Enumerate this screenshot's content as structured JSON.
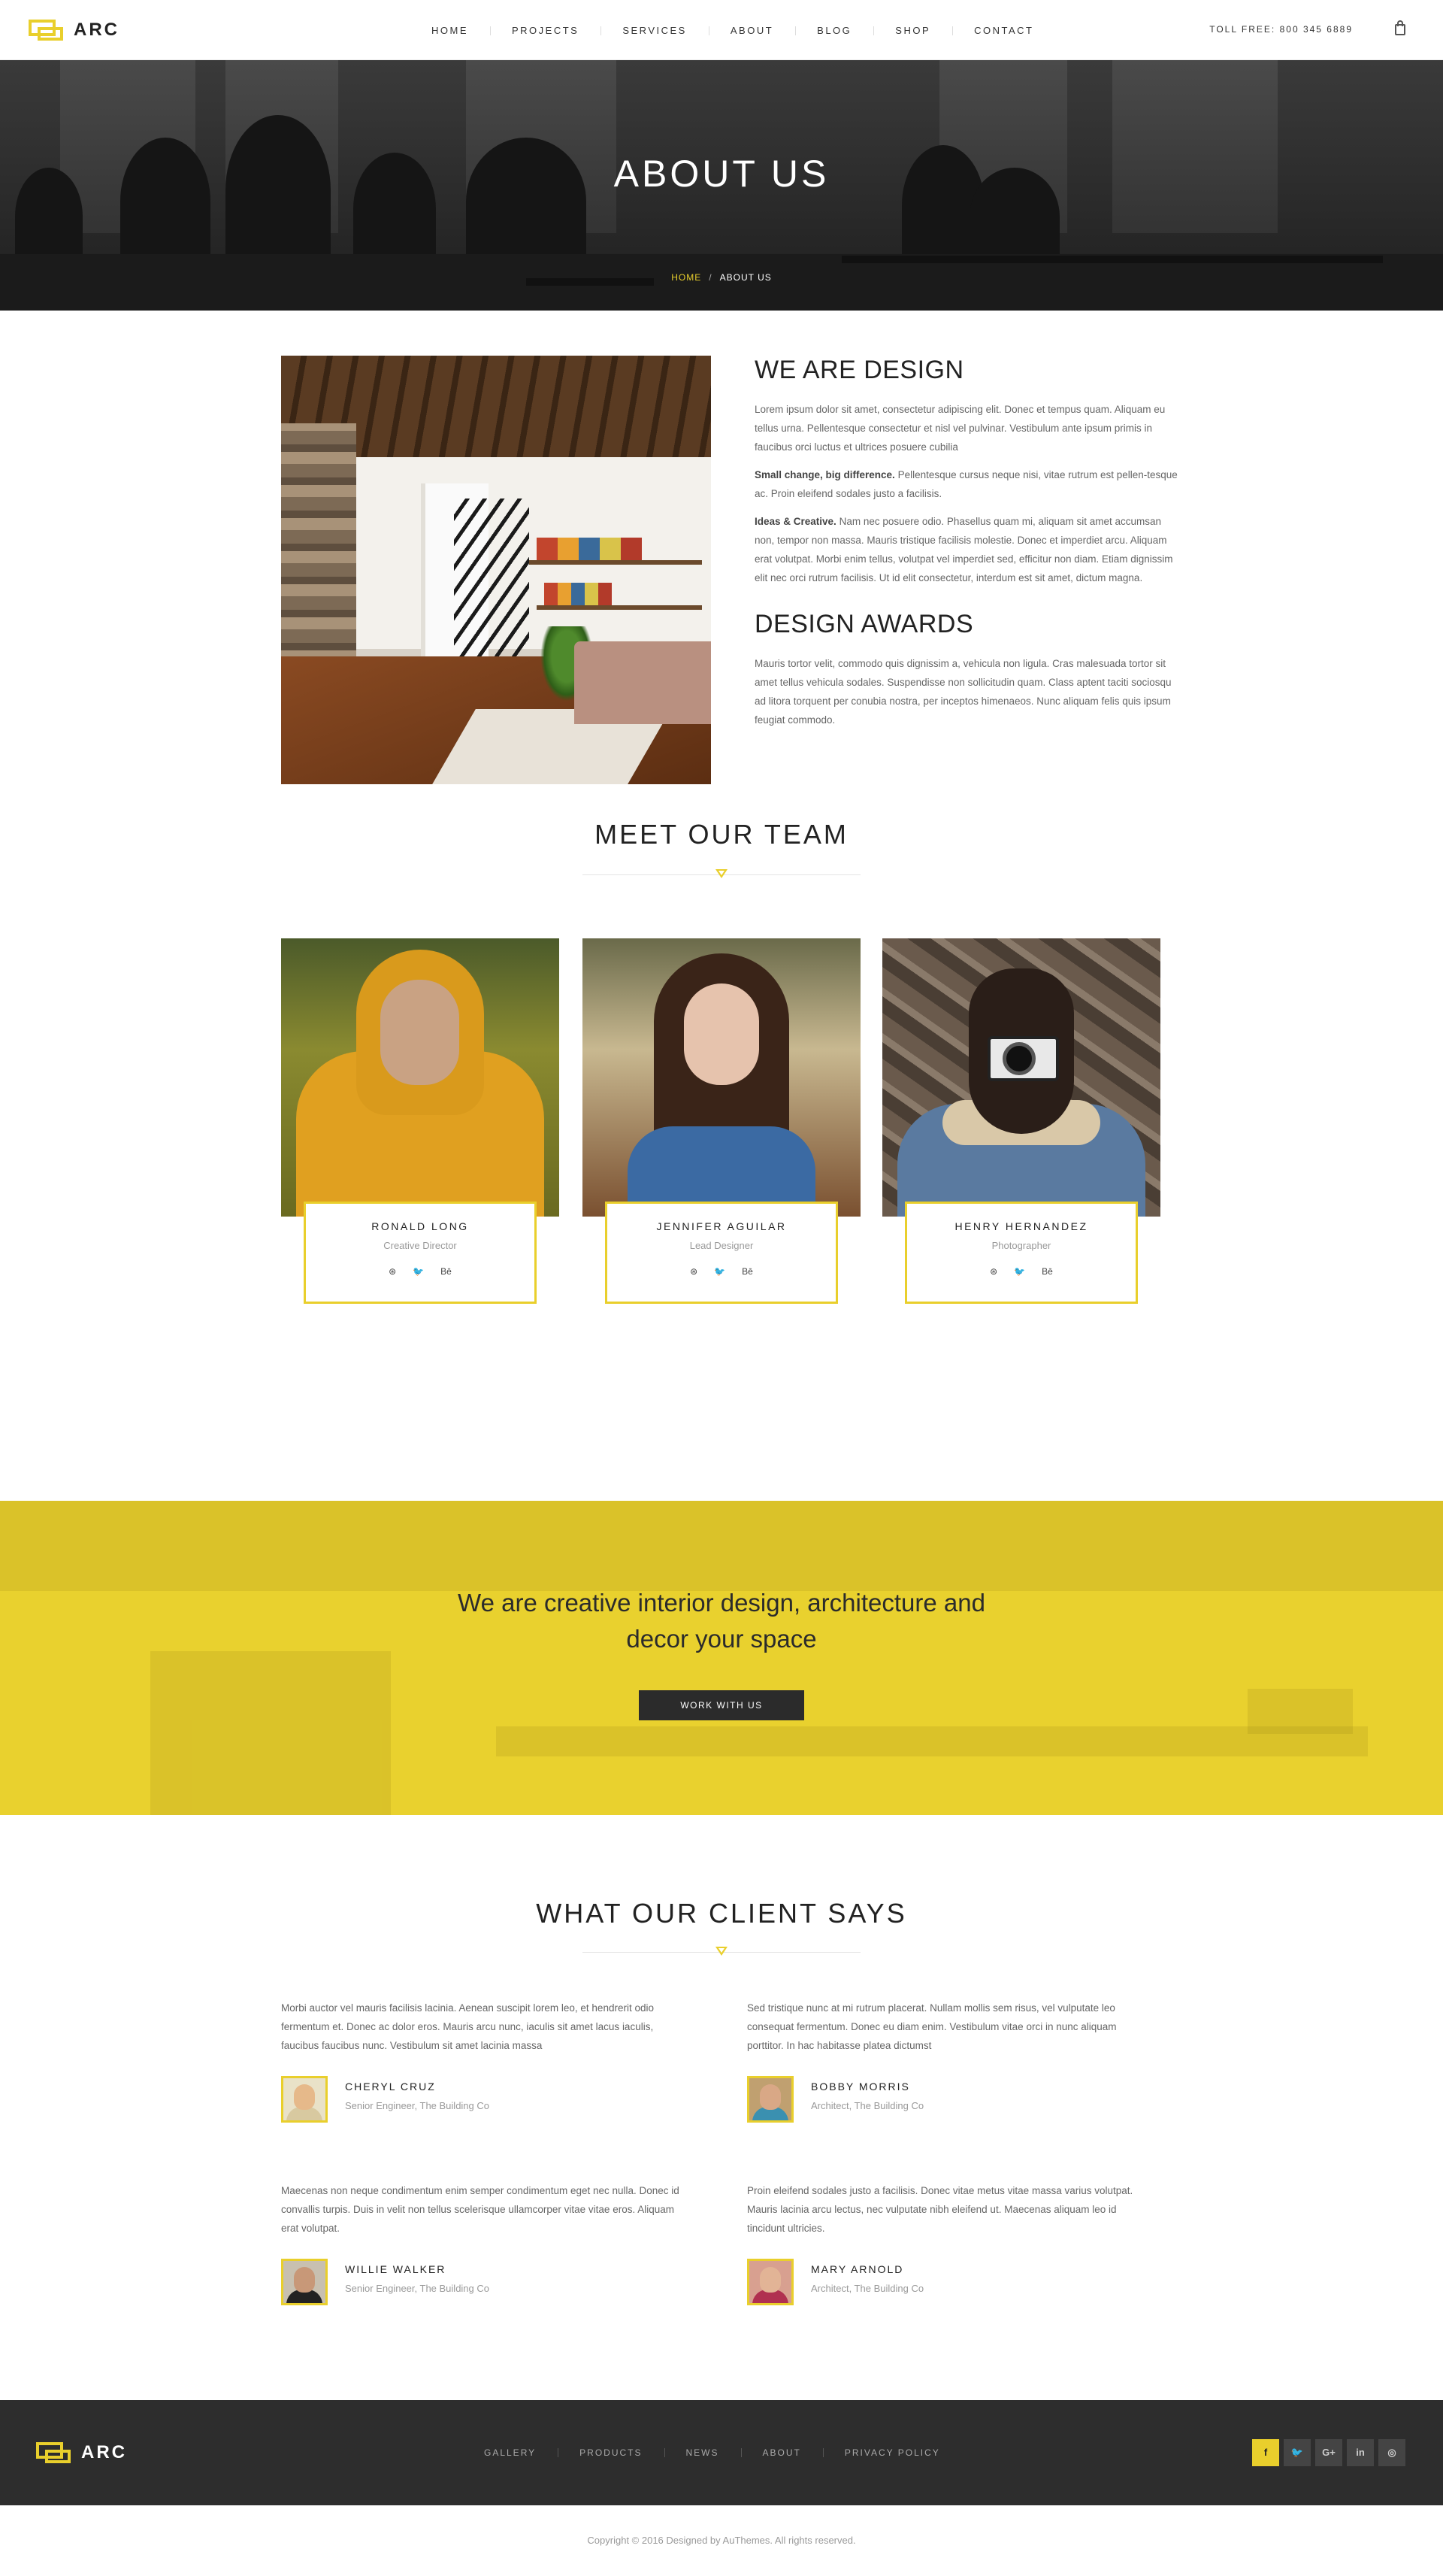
{
  "brand": {
    "name": "ARC",
    "accent": "#e9cf2c",
    "dark": "#2d2d2d"
  },
  "nav": {
    "items": [
      "HOME",
      "PROJECTS",
      "SERVICES",
      "ABOUT",
      "BLOG",
      "SHOP",
      "CONTACT"
    ],
    "tollfree": "TOLL FREE: 800 345 6889",
    "cart_icon": "shopping-bag-icon"
  },
  "hero": {
    "title": "ABOUT US",
    "breadcrumb": {
      "home": "HOME",
      "separator": "/",
      "current": "ABOUT US"
    }
  },
  "about": {
    "heading": "WE ARE DESIGN",
    "p1": "Lorem ipsum dolor sit amet, consectetur adipiscing elit. Donec et tempus quam. Aliquam eu tellus urna. Pellentesque consectetur et nisl vel pulvinar. Vestibulum ante ipsum primis in faucibus orci luctus et ultrices posuere cubilia",
    "p2_bold": "Small change, big difference.",
    "p2": " Pellentesque cursus neque nisi, vitae rutrum est pellen-tesque ac. Proin eleifend sodales justo a facilisis.",
    "p3_bold": "Ideas & Creative.",
    "p3": " Nam nec posuere odio. Phasellus quam mi, aliquam sit amet accumsan non, tempor non massa. Mauris tristique facilisis molestie. Donec et imperdiet arcu. Aliquam erat volutpat. Morbi enim tellus, volutpat vel imperdiet sed, efficitur non diam. Etiam dignissim elit nec orci rutrum facilisis. Ut id elit consectetur, interdum est sit amet, dictum magna.",
    "awards_heading": "DESIGN AWARDS",
    "awards_text": "Mauris tortor velit, commodo quis dignissim a, vehicula non ligula. Cras malesuada tortor sit amet tellus vehicula sodales. Suspendisse non sollicitudin quam. Class aptent taciti sociosqu ad litora torquent per conubia nostra, per inceptos himenaeos. Nunc aliquam felis quis ipsum feugiat commodo."
  },
  "team": {
    "title": "MEET OUR TEAM",
    "members": [
      {
        "name": "RONALD LONG",
        "role": "Creative Director"
      },
      {
        "name": "JENNIFER AGUILAR",
        "role": "Lead Designer"
      },
      {
        "name": "HENRY HERNANDEZ",
        "role": "Photographer"
      }
    ],
    "social_icons": [
      "dribbble-icon",
      "twitter-icon",
      "behance-icon"
    ],
    "social_glyphs": [
      "⊛",
      "🐦",
      "Bē"
    ]
  },
  "cta": {
    "line1": "We are creative interior design, architecture and",
    "line2": "decor your space",
    "button": "WORK WITH US"
  },
  "clients": {
    "title": "WHAT OUR CLIENT SAYS",
    "items": [
      {
        "quote": "Morbi auctor vel mauris facilisis lacinia. Aenean suscipit lorem leo, et hendrerit odio fermentum et. Donec ac dolor eros. Mauris arcu nunc, iaculis sit amet lacus iaculis, faucibus faucibus nunc. Vestibulum sit amet lacinia massa",
        "name": "CHERYL CRUZ",
        "role": "Senior Engineer, The Building Co"
      },
      {
        "quote": "Sed tristique nunc at mi rutrum placerat. Nullam mollis sem risus, vel vulputate leo consequat fermentum. Donec eu diam enim. Vestibulum vitae orci in nunc aliquam porttitor. In hac habitasse platea dictumst",
        "name": "BOBBY MORRIS",
        "role": "Architect, The Building Co"
      },
      {
        "quote": "Maecenas non neque condimentum enim semper condimentum eget nec nulla. Donec id convallis turpis. Duis in velit non tellus scelerisque ullamcorper vitae vitae eros. Aliquam erat volutpat.",
        "name": "WILLIE WALKER",
        "role": "Senior Engineer, The Building Co"
      },
      {
        "quote": "Proin eleifend sodales justo a facilisis. Donec vitae metus vitae massa varius volutpat. Mauris lacinia arcu lectus, nec vulputate nibh eleifend ut. Maecenas aliquam leo id tincidunt ultricies.",
        "name": "MARY ARNOLD",
        "role": "Architect, The Building Co"
      }
    ]
  },
  "footer": {
    "links": [
      "GALLERY",
      "PRODUCTS",
      "NEWS",
      "ABOUT",
      "PRIVACY POLICY"
    ],
    "social": [
      {
        "icon": "facebook-icon",
        "glyph": "f"
      },
      {
        "icon": "twitter-icon",
        "glyph": "🐦"
      },
      {
        "icon": "google-plus-icon",
        "glyph": "G+"
      },
      {
        "icon": "linkedin-icon",
        "glyph": "in"
      },
      {
        "icon": "instagram-icon",
        "glyph": "◎"
      }
    ],
    "copyright": "Copyright © 2016 Designed by AuThemes. All rights reserved."
  }
}
